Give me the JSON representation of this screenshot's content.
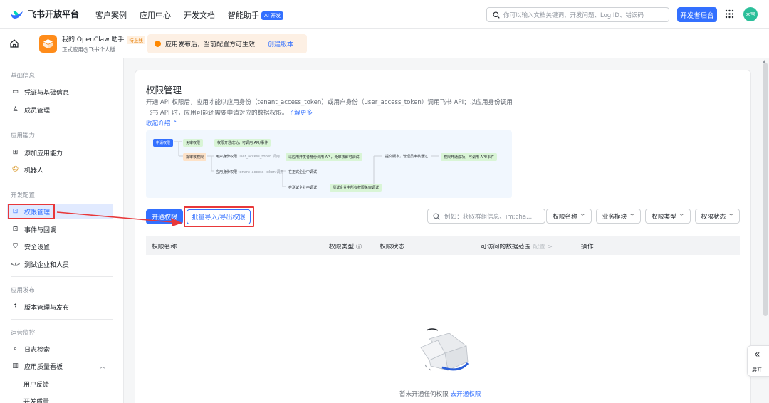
{
  "topnav": {
    "logo_text": "飞书开放平台",
    "links": [
      "客户案例",
      "应用中心",
      "开发文档",
      "智能助手"
    ],
    "ai_badge": "AI 开发",
    "search_placeholder": "你可以输入文档关键词、开发问题、Log ID、错误码",
    "dev_console": "开发者后台",
    "avatar_text": "大宝"
  },
  "appbar": {
    "app_name": "我的 OpenClaw 助手",
    "app_status": "待上线",
    "app_sub": "正式应用@飞书个人版",
    "notice_text": "应用发布后，当前配置方可生效",
    "notice_link": "创建版本"
  },
  "sidebar": {
    "sections": [
      {
        "title": "基础信息",
        "items": [
          "凭证与基础信息",
          "成员管理"
        ]
      },
      {
        "title": "应用能力",
        "items": [
          "添加应用能力",
          "机器人"
        ]
      },
      {
        "title": "开发配置",
        "items": [
          "权限管理",
          "事件与回调",
          "安全设置",
          "测试企业和人员"
        ]
      },
      {
        "title": "应用发布",
        "items": [
          "版本管理与发布"
        ]
      },
      {
        "title": "运营监控",
        "items": [
          "日志检索",
          "应用质量看板"
        ]
      }
    ],
    "subitems": [
      "用户反馈",
      "开发质量"
    ],
    "active_item": "权限管理"
  },
  "main": {
    "title": "权限管理",
    "desc": "开通 API 权限后，应用才能以应用身份（tenant_access_token）或用户身份（user_access_token）调用飞书 API；以应用身份调用飞书 API 时，应用可能还需要申请对应的数据权限。",
    "learn_more": "了解更多",
    "collapse": "收起介绍",
    "flow": {
      "apply": "申请权限",
      "free": "免审权限",
      "free_result": "权限开通成功，可调用 API/事件",
      "review": "需审核权限",
      "user_perm": "用户身份权限",
      "user_token": "user_access_token 调用",
      "debug_ok": "以应用开发者身份调用 API，免审核即可调试",
      "submit": "提交版本，管理员审核通过",
      "final_ok": "权限开通成功，可调用 API/事件",
      "app_perm": "应用身份权限",
      "tenant_token": "tenant_access_token 调用",
      "formal_debug": "在正式企业中调试",
      "test_debug": "在测试企业中调试",
      "test_ok": "测试企业中所有权限免审调试"
    },
    "open_btn": "开通权限",
    "batch_btn": "批量导入/导出权限",
    "filter_placeholder": "例如：获取群组信息、im:cha...",
    "filters": [
      "权限名称",
      "业务模块",
      "权限类型",
      "权限状态"
    ],
    "columns": [
      "权限名称",
      "权限类型",
      "权限状态",
      "可访问的数据范围",
      "配置",
      "操作"
    ],
    "empty_text": "暂未开通任何权限",
    "empty_link": "去开通权限"
  },
  "expand_label": "展开",
  "colors": {
    "primary": "#3370ff",
    "highlight": "#e8383a",
    "notice_bg": "#fdf0e4"
  }
}
